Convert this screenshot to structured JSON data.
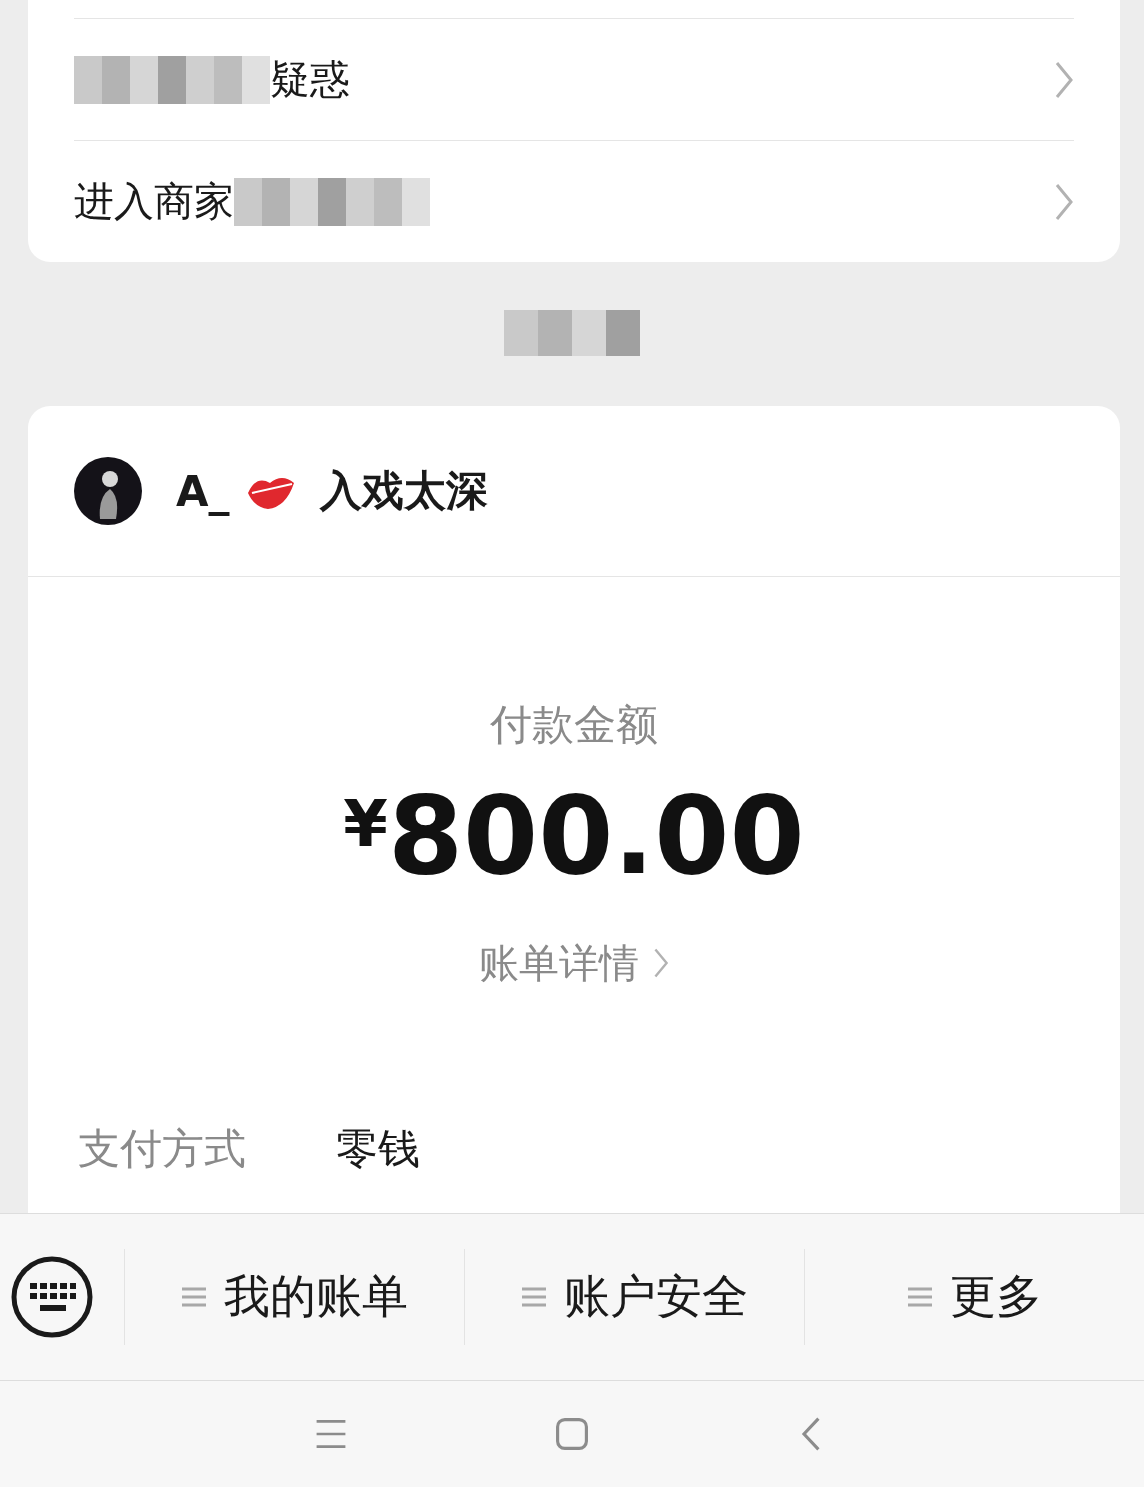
{
  "menu_rows": [
    {
      "parts": [
        {
          "kind": "redaction"
        },
        {
          "kind": "text",
          "label": "疑惑"
        }
      ]
    },
    {
      "parts": [
        {
          "kind": "text",
          "label": "进入商家"
        },
        {
          "kind": "redaction"
        }
      ]
    }
  ],
  "section_label": {
    "kind": "redaction"
  },
  "payee": {
    "prefix": "A_",
    "name": "入戏太深"
  },
  "payment": {
    "amount_label": "付款金额",
    "currency": "¥",
    "amount": "800.00",
    "details_link": "账单详情"
  },
  "method": {
    "label": "支付方式",
    "value": "零钱"
  },
  "bottom_menu": [
    {
      "label": "我的账单"
    },
    {
      "label": "账户安全"
    },
    {
      "label": "更多"
    }
  ]
}
